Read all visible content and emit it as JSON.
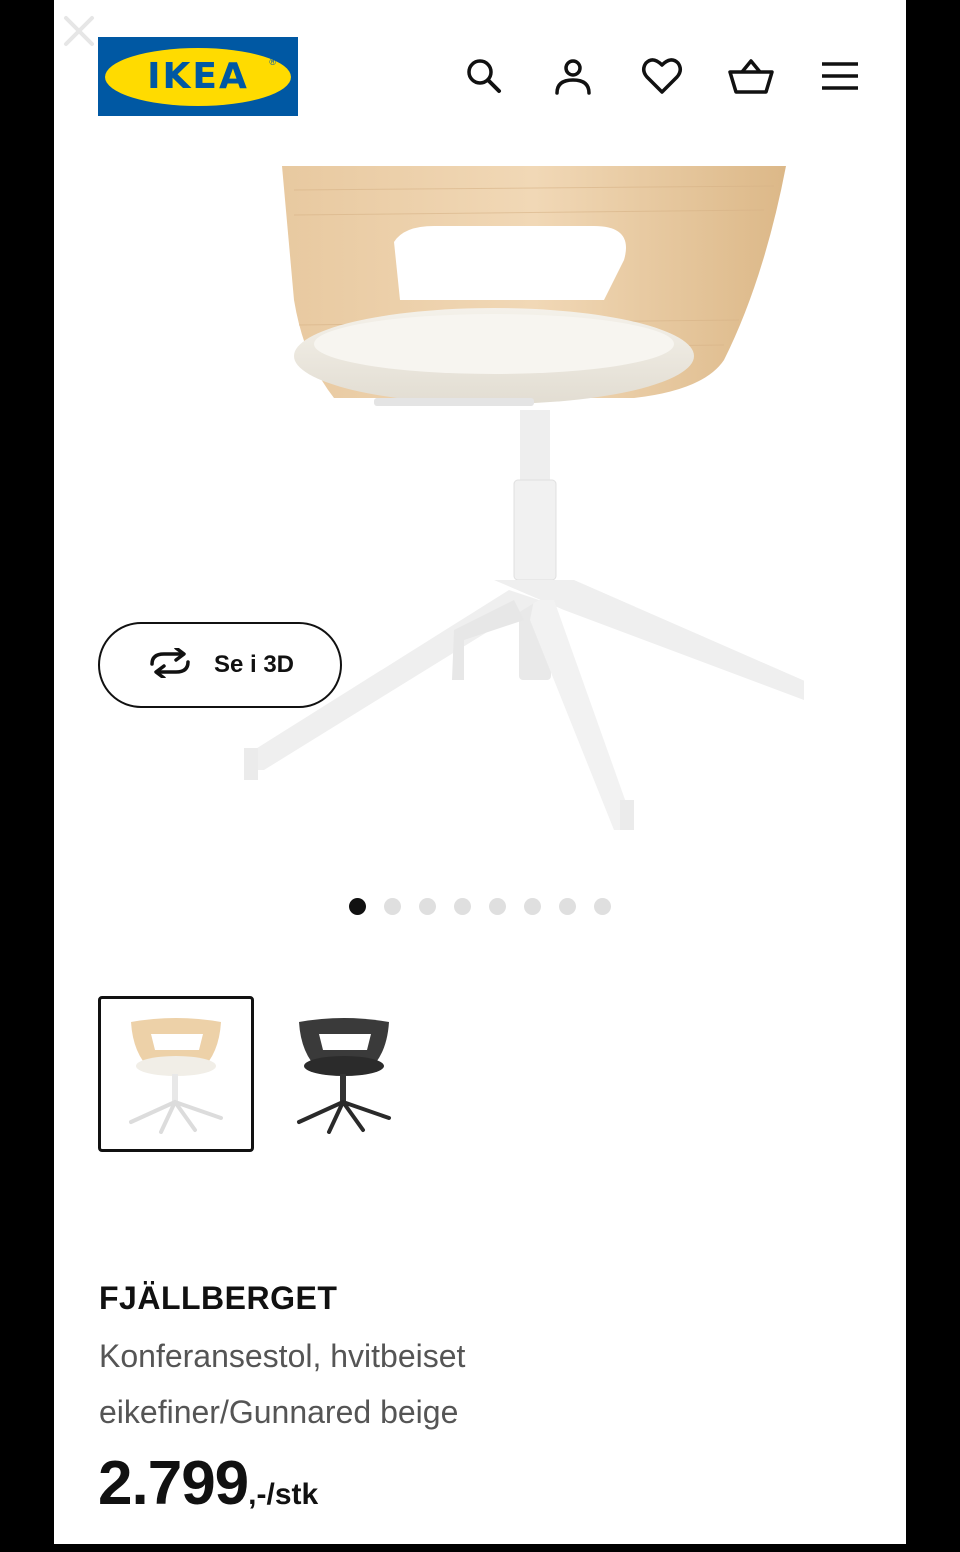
{
  "header": {
    "logo_text": "IKEA",
    "logo_reg": "®",
    "icons": [
      "search-icon",
      "user-icon",
      "heart-icon",
      "basket-icon",
      "menu-icon"
    ]
  },
  "overlay": {
    "close_icon": "close-icon"
  },
  "gallery": {
    "view_3d_label": "Se i 3D",
    "view_3d_icon": "rotate-icon",
    "dot_count": 8,
    "active_dot": 1
  },
  "variants": [
    {
      "name": "white-oak-beige",
      "selected": true
    },
    {
      "name": "black",
      "selected": false
    }
  ],
  "product": {
    "name": "FJÄLLBERGET",
    "description_line1": "Konferansestol, hvitbeiset",
    "description_line2": "eikefiner/Gunnared beige",
    "price_main": "2.799",
    "price_suffix": ",-/stk"
  },
  "colors": {
    "brand_blue": "#0058a3",
    "brand_yellow": "#ffdb00",
    "text_dark": "#111111",
    "text_muted": "#555555"
  }
}
